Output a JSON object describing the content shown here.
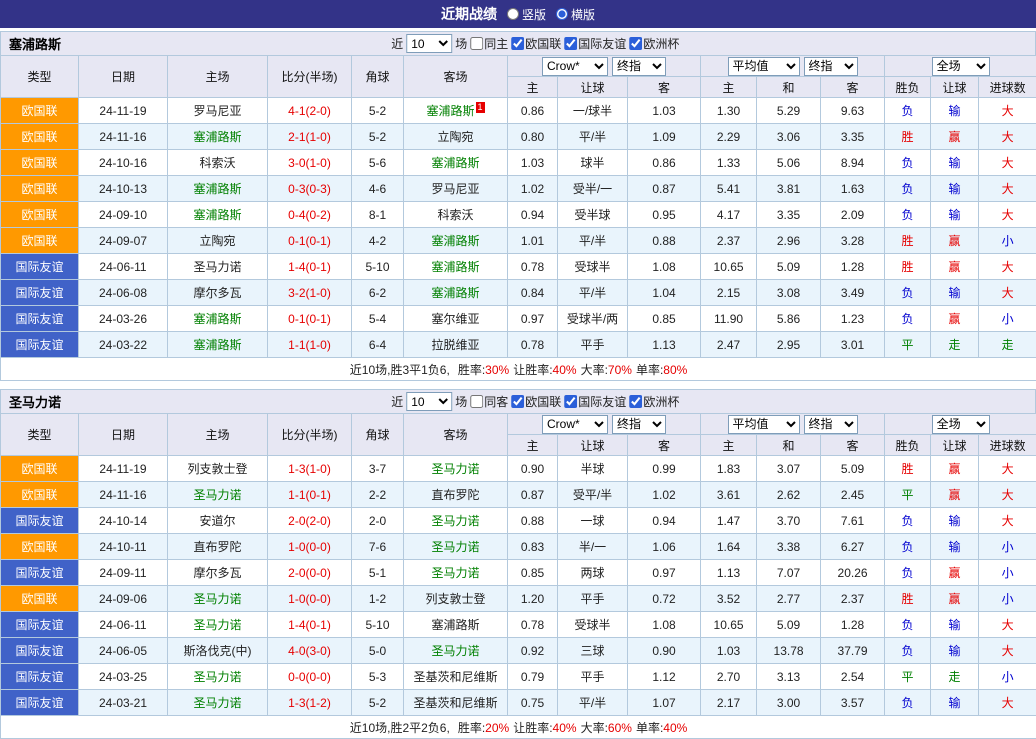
{
  "title_bar": {
    "title": "近期战绩",
    "view_options": [
      {
        "label": "竖版",
        "selected": false
      },
      {
        "label": "横版",
        "selected": true
      }
    ]
  },
  "filter": {
    "near": "近",
    "games": "10",
    "games_unit": "场",
    "leagues": [
      "欧国联",
      "国际友谊",
      "欧洲杯"
    ]
  },
  "dropdowns": {
    "bookmaker": "Crow*",
    "odds_stage": "终指",
    "average": "平均值",
    "avg_stage": "终指",
    "scope": "全场"
  },
  "columns": {
    "type": "类型",
    "date": "日期",
    "home": "主场",
    "score": "比分(半场)",
    "corner": "角球",
    "away": "客场",
    "odds_home": "主",
    "odds_handicap": "让球",
    "odds_away": "客",
    "avg_home": "主",
    "avg_draw": "和",
    "avg_away": "客",
    "result_winlose": "胜负",
    "result_handicap": "让球",
    "result_goals": "进球数"
  },
  "colors": {
    "title_bar_bg": "#333388",
    "nations_league_badge": "#ff9900",
    "friendly_badge": "#4062c8",
    "win_over_red": "#e60000",
    "lose_under_blue": "#0000d0",
    "draw_push_green": "#008000",
    "self_team_green": "#008000",
    "alt_row_bg": "#e9f4fc",
    "header_bg": "#e7e7f3"
  },
  "sections": [
    {
      "team": "塞浦路斯",
      "same_venue": {
        "label": "同主",
        "checked": false
      },
      "league_checks": [
        true,
        true,
        true
      ],
      "rows": [
        {
          "type": "欧国联",
          "date": "24-11-19",
          "home": "罗马尼亚",
          "score": "4-1(2-0)",
          "corner": "5-2",
          "away": "塞浦路斯",
          "away_self": true,
          "away_note": "1",
          "odds": [
            "0.86",
            "一/球半",
            "1.03"
          ],
          "avg": [
            "1.30",
            "5.29",
            "9.63"
          ],
          "results": [
            [
              "负",
              "b"
            ],
            [
              "输",
              "b"
            ],
            [
              "大",
              "r"
            ]
          ]
        },
        {
          "type": "欧国联",
          "date": "24-11-16",
          "home": "塞浦路斯",
          "home_self": true,
          "score": "2-1(1-0)",
          "corner": "5-2",
          "away": "立陶宛",
          "odds": [
            "0.80",
            "平/半",
            "1.09"
          ],
          "avg": [
            "2.29",
            "3.06",
            "3.35"
          ],
          "results": [
            [
              "胜",
              "r"
            ],
            [
              "赢",
              "r"
            ],
            [
              "大",
              "r"
            ]
          ]
        },
        {
          "type": "欧国联",
          "date": "24-10-16",
          "home": "科索沃",
          "score": "3-0(1-0)",
          "corner": "5-6",
          "away": "塞浦路斯",
          "away_self": true,
          "odds": [
            "1.03",
            "球半",
            "0.86"
          ],
          "avg": [
            "1.33",
            "5.06",
            "8.94"
          ],
          "results": [
            [
              "负",
              "b"
            ],
            [
              "输",
              "b"
            ],
            [
              "大",
              "r"
            ]
          ]
        },
        {
          "type": "欧国联",
          "date": "24-10-13",
          "home": "塞浦路斯",
          "home_self": true,
          "score": "0-3(0-3)",
          "corner": "4-6",
          "away": "罗马尼亚",
          "odds": [
            "1.02",
            "受半/一",
            "0.87"
          ],
          "avg": [
            "5.41",
            "3.81",
            "1.63"
          ],
          "results": [
            [
              "负",
              "b"
            ],
            [
              "输",
              "b"
            ],
            [
              "大",
              "r"
            ]
          ]
        },
        {
          "type": "欧国联",
          "date": "24-09-10",
          "home": "塞浦路斯",
          "home_self": true,
          "score": "0-4(0-2)",
          "corner": "8-1",
          "away": "科索沃",
          "odds": [
            "0.94",
            "受半球",
            "0.95"
          ],
          "avg": [
            "4.17",
            "3.35",
            "2.09"
          ],
          "results": [
            [
              "负",
              "b"
            ],
            [
              "输",
              "b"
            ],
            [
              "大",
              "r"
            ]
          ]
        },
        {
          "type": "欧国联",
          "date": "24-09-07",
          "home": "立陶宛",
          "score": "0-1(0-1)",
          "corner": "4-2",
          "away": "塞浦路斯",
          "away_self": true,
          "odds": [
            "1.01",
            "平/半",
            "0.88"
          ],
          "avg": [
            "2.37",
            "2.96",
            "3.28"
          ],
          "results": [
            [
              "胜",
              "r"
            ],
            [
              "赢",
              "r"
            ],
            [
              "小",
              "b"
            ]
          ]
        },
        {
          "type": "国际友谊",
          "date": "24-06-11",
          "home": "圣马力诺",
          "score": "1-4(0-1)",
          "corner": "5-10",
          "away": "塞浦路斯",
          "away_self": true,
          "odds": [
            "0.78",
            "受球半",
            "1.08"
          ],
          "avg": [
            "10.65",
            "5.09",
            "1.28"
          ],
          "results": [
            [
              "胜",
              "r"
            ],
            [
              "赢",
              "r"
            ],
            [
              "大",
              "r"
            ]
          ]
        },
        {
          "type": "国际友谊",
          "date": "24-06-08",
          "home": "摩尔多瓦",
          "score": "3-2(1-0)",
          "corner": "6-2",
          "away": "塞浦路斯",
          "away_self": true,
          "odds": [
            "0.84",
            "平/半",
            "1.04"
          ],
          "avg": [
            "2.15",
            "3.08",
            "3.49"
          ],
          "results": [
            [
              "负",
              "b"
            ],
            [
              "输",
              "b"
            ],
            [
              "大",
              "r"
            ]
          ]
        },
        {
          "type": "国际友谊",
          "date": "24-03-26",
          "home": "塞浦路斯",
          "home_self": true,
          "score": "0-1(0-1)",
          "corner": "5-4",
          "away": "塞尔维亚",
          "odds": [
            "0.97",
            "受球半/两",
            "0.85"
          ],
          "avg": [
            "11.90",
            "5.86",
            "1.23"
          ],
          "results": [
            [
              "负",
              "b"
            ],
            [
              "赢",
              "r"
            ],
            [
              "小",
              "b"
            ]
          ]
        },
        {
          "type": "国际友谊",
          "date": "24-03-22",
          "home": "塞浦路斯",
          "home_self": true,
          "score": "1-1(1-0)",
          "corner": "6-4",
          "away": "拉脱维亚",
          "odds": [
            "0.78",
            "平手",
            "1.13"
          ],
          "avg": [
            "2.47",
            "2.95",
            "3.01"
          ],
          "results": [
            [
              "平",
              "g"
            ],
            [
              "走",
              "g"
            ],
            [
              "走",
              "g"
            ]
          ]
        }
      ],
      "summary": {
        "record": "近10场,胜3平1负6,",
        "stats": [
          {
            "label": "胜率:",
            "value": "30%"
          },
          {
            "label": "让胜率:",
            "value": "40%"
          },
          {
            "label": "大率:",
            "value": "70%"
          },
          {
            "label": "单率:",
            "value": "80%"
          }
        ]
      }
    },
    {
      "team": "圣马力诺",
      "same_venue": {
        "label": "同客",
        "checked": false
      },
      "league_checks": [
        true,
        true,
        true
      ],
      "rows": [
        {
          "type": "欧国联",
          "date": "24-11-19",
          "home": "列支敦士登",
          "score": "1-3(1-0)",
          "corner": "3-7",
          "away": "圣马力诺",
          "away_self": true,
          "odds": [
            "0.90",
            "半球",
            "0.99"
          ],
          "avg": [
            "1.83",
            "3.07",
            "5.09"
          ],
          "results": [
            [
              "胜",
              "r"
            ],
            [
              "赢",
              "r"
            ],
            [
              "大",
              "r"
            ]
          ]
        },
        {
          "type": "欧国联",
          "date": "24-11-16",
          "home": "圣马力诺",
          "home_self": true,
          "score": "1-1(0-1)",
          "corner": "2-2",
          "away": "直布罗陀",
          "odds": [
            "0.87",
            "受平/半",
            "1.02"
          ],
          "avg": [
            "3.61",
            "2.62",
            "2.45"
          ],
          "results": [
            [
              "平",
              "g"
            ],
            [
              "赢",
              "r"
            ],
            [
              "大",
              "r"
            ]
          ]
        },
        {
          "type": "国际友谊",
          "date": "24-10-14",
          "home": "安道尔",
          "score": "2-0(2-0)",
          "corner": "2-0",
          "away": "圣马力诺",
          "away_self": true,
          "odds": [
            "0.88",
            "一球",
            "0.94"
          ],
          "avg": [
            "1.47",
            "3.70",
            "7.61"
          ],
          "results": [
            [
              "负",
              "b"
            ],
            [
              "输",
              "b"
            ],
            [
              "大",
              "r"
            ]
          ]
        },
        {
          "type": "欧国联",
          "date": "24-10-11",
          "home": "直布罗陀",
          "score": "1-0(0-0)",
          "corner": "7-6",
          "away": "圣马力诺",
          "away_self": true,
          "odds": [
            "0.83",
            "半/一",
            "1.06"
          ],
          "avg": [
            "1.64",
            "3.38",
            "6.27"
          ],
          "results": [
            [
              "负",
              "b"
            ],
            [
              "输",
              "b"
            ],
            [
              "小",
              "b"
            ]
          ]
        },
        {
          "type": "国际友谊",
          "date": "24-09-11",
          "home": "摩尔多瓦",
          "score": "2-0(0-0)",
          "corner": "5-1",
          "away": "圣马力诺",
          "away_self": true,
          "odds": [
            "0.85",
            "两球",
            "0.97"
          ],
          "avg": [
            "1.13",
            "7.07",
            "20.26"
          ],
          "results": [
            [
              "负",
              "b"
            ],
            [
              "赢",
              "r"
            ],
            [
              "小",
              "b"
            ]
          ]
        },
        {
          "type": "欧国联",
          "date": "24-09-06",
          "home": "圣马力诺",
          "home_self": true,
          "score": "1-0(0-0)",
          "corner": "1-2",
          "away": "列支敦士登",
          "odds": [
            "1.20",
            "平手",
            "0.72"
          ],
          "avg": [
            "3.52",
            "2.77",
            "2.37"
          ],
          "results": [
            [
              "胜",
              "r"
            ],
            [
              "赢",
              "r"
            ],
            [
              "小",
              "b"
            ]
          ]
        },
        {
          "type": "国际友谊",
          "date": "24-06-11",
          "home": "圣马力诺",
          "home_self": true,
          "score": "1-4(0-1)",
          "corner": "5-10",
          "away": "塞浦路斯",
          "odds": [
            "0.78",
            "受球半",
            "1.08"
          ],
          "avg": [
            "10.65",
            "5.09",
            "1.28"
          ],
          "results": [
            [
              "负",
              "b"
            ],
            [
              "输",
              "b"
            ],
            [
              "大",
              "r"
            ]
          ]
        },
        {
          "type": "国际友谊",
          "date": "24-06-05",
          "home": "斯洛伐克(中)",
          "score": "4-0(3-0)",
          "corner": "5-0",
          "away": "圣马力诺",
          "away_self": true,
          "odds": [
            "0.92",
            "三球",
            "0.90"
          ],
          "avg": [
            "1.03",
            "13.78",
            "37.79"
          ],
          "results": [
            [
              "负",
              "b"
            ],
            [
              "输",
              "b"
            ],
            [
              "大",
              "r"
            ]
          ]
        },
        {
          "type": "国际友谊",
          "date": "24-03-25",
          "home": "圣马力诺",
          "home_self": true,
          "score": "0-0(0-0)",
          "corner": "5-3",
          "away": "圣基茨和尼维斯",
          "odds": [
            "0.79",
            "平手",
            "1.12"
          ],
          "avg": [
            "2.70",
            "3.13",
            "2.54"
          ],
          "results": [
            [
              "平",
              "g"
            ],
            [
              "走",
              "g"
            ],
            [
              "小",
              "b"
            ]
          ]
        },
        {
          "type": "国际友谊",
          "date": "24-03-21",
          "home": "圣马力诺",
          "home_self": true,
          "score": "1-3(1-2)",
          "corner": "5-2",
          "away": "圣基茨和尼维斯",
          "odds": [
            "0.75",
            "平/半",
            "1.07"
          ],
          "avg": [
            "2.17",
            "3.00",
            "3.57"
          ],
          "results": [
            [
              "负",
              "b"
            ],
            [
              "输",
              "b"
            ],
            [
              "大",
              "r"
            ]
          ]
        }
      ],
      "summary": {
        "record": "近10场,胜2平2负6,",
        "stats": [
          {
            "label": "胜率:",
            "value": "20%"
          },
          {
            "label": "让胜率:",
            "value": "40%"
          },
          {
            "label": "大率:",
            "value": "60%"
          },
          {
            "label": "单率:",
            "value": "40%"
          }
        ]
      }
    }
  ]
}
